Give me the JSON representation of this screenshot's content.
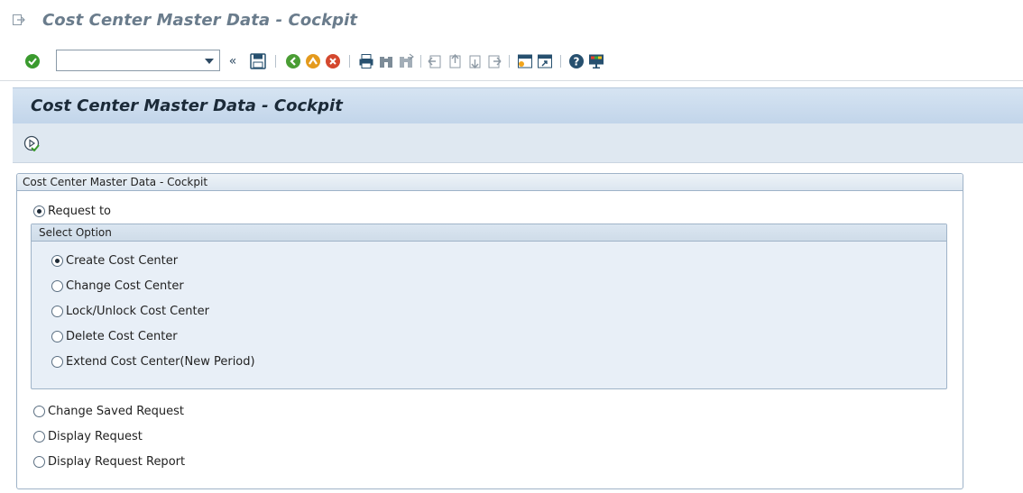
{
  "window": {
    "title": "Cost Center Master Data - Cockpit",
    "menu_icon": "menu-expand-icon"
  },
  "toolbar": {
    "command_field_value": "",
    "icons": [
      "enter-icon",
      "dropdown-icon",
      "collapse-icon",
      "save-icon",
      "back-icon",
      "exit-icon",
      "cancel-icon",
      "print-icon",
      "find-icon",
      "find-next-icon",
      "first-page-icon",
      "previous-page-icon",
      "next-page-icon",
      "last-page-icon",
      "create-session-icon",
      "shortcut-icon",
      "help-icon",
      "customize-layout-icon"
    ]
  },
  "screen": {
    "title": "Cost Center Master Data - Cockpit",
    "execute_icon": "execute-icon"
  },
  "main_group": {
    "title": "Cost Center Master Data - Cockpit",
    "options": [
      {
        "label": "Request to",
        "checked": true
      },
      {
        "label": "Change Saved Request",
        "checked": false
      },
      {
        "label": "Display Request",
        "checked": false
      },
      {
        "label": "Display Request Report",
        "checked": false
      }
    ],
    "select_option": {
      "title": "Select Option",
      "options": [
        {
          "label": "Create Cost Center",
          "checked": true
        },
        {
          "label": "Change Cost Center",
          "checked": false
        },
        {
          "label": "Lock/Unlock Cost Center",
          "checked": false
        },
        {
          "label": "Delete Cost Center",
          "checked": false
        },
        {
          "label": "Extend Cost Center(New Period)",
          "checked": false
        }
      ]
    }
  },
  "colors": {
    "title_text": "#6a7c8c",
    "header_bg": "#c2d5ea",
    "group_border": "#9fb3c8",
    "subgroup_bg": "#e8eff7"
  }
}
